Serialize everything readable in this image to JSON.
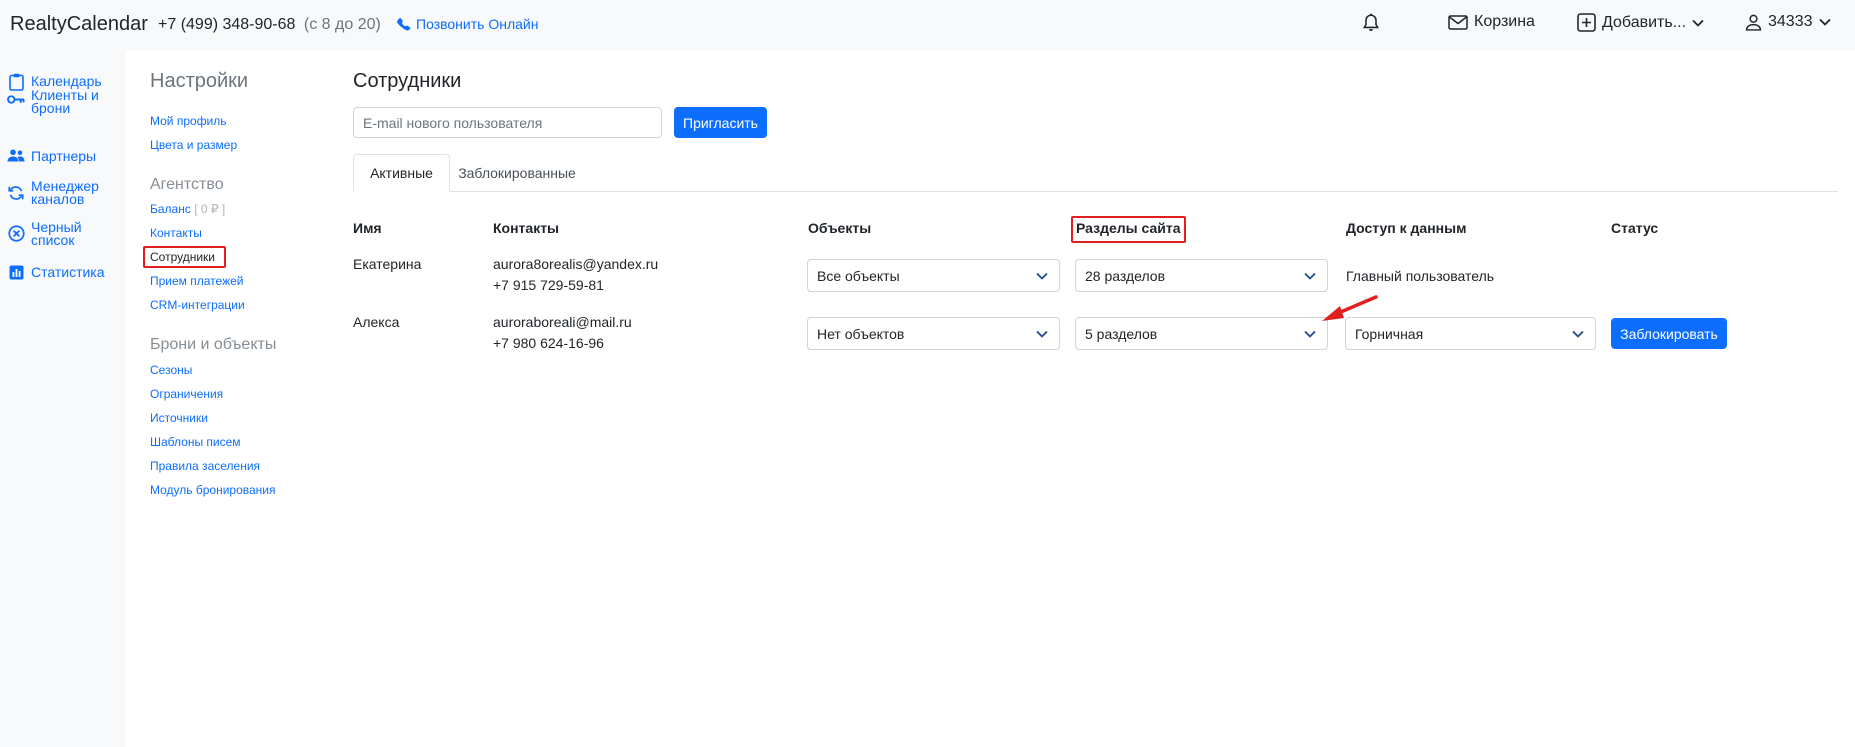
{
  "topbar": {
    "brand": "RealtyCalendar",
    "phone": "+7 (499) 348-90-68",
    "phone_hours": "(с 8 до 20)",
    "call_online": "Позвонить Онлайн",
    "cart": "Корзина",
    "add": "Добавить...",
    "user_id": "34333"
  },
  "leftnav": {
    "items": [
      {
        "label": "Календарь",
        "icon": "clipboard-icon"
      },
      {
        "label": "Клиенты и брони",
        "icon": "key-icon"
      },
      {
        "label": "Партнеры",
        "icon": "people-icon"
      },
      {
        "label": "Менеджер каналов",
        "icon": "sync-icon"
      },
      {
        "label": "Черный список",
        "icon": "x-circle-icon"
      },
      {
        "label": "Статистика",
        "icon": "bar-chart-icon"
      }
    ]
  },
  "settings": {
    "title": "Настройки",
    "links_top": [
      "Мой профиль",
      "Цвета и размер"
    ],
    "agency_section": "Агентство",
    "balance_label": "Баланс",
    "balance_value": "[ 0 ₽ ]",
    "agency_links": [
      "Контакты",
      "Сотрудники",
      "Прием платежей",
      "CRM-интеграции"
    ],
    "bookings_section": "Брони и объекты",
    "bookings_links": [
      "Сезоны",
      "Ограничения",
      "Источники",
      "Шаблоны писем",
      "Правила заселения",
      "Модуль бронирования"
    ]
  },
  "main": {
    "title": "Сотрудники",
    "invite_placeholder": "E-mail нового пользователя",
    "invite_button": "Пригласить",
    "tabs": [
      "Активные",
      "Заблокированные"
    ],
    "columns": [
      "Имя",
      "Контакты",
      "Объекты",
      "Разделы сайта",
      "Доступ к данным",
      "Статус"
    ],
    "rows": [
      {
        "name": "Екатерина",
        "email": "aurora8orealis@yandex.ru",
        "phone": "+7 915 729-59-81",
        "objects": "Все объекты",
        "sections": "28 разделов",
        "access": "Главный пользователь"
      },
      {
        "name": "Алекса",
        "email": "auroraboreali@mail.ru",
        "phone": "+7 980 624-16-96",
        "objects": "Нет объектов",
        "sections": "5 разделов",
        "access": "Горничная",
        "status_button": "Заблокировать"
      }
    ]
  },
  "colors": {
    "accent": "#0d6efd",
    "annotation": "#e02020"
  }
}
